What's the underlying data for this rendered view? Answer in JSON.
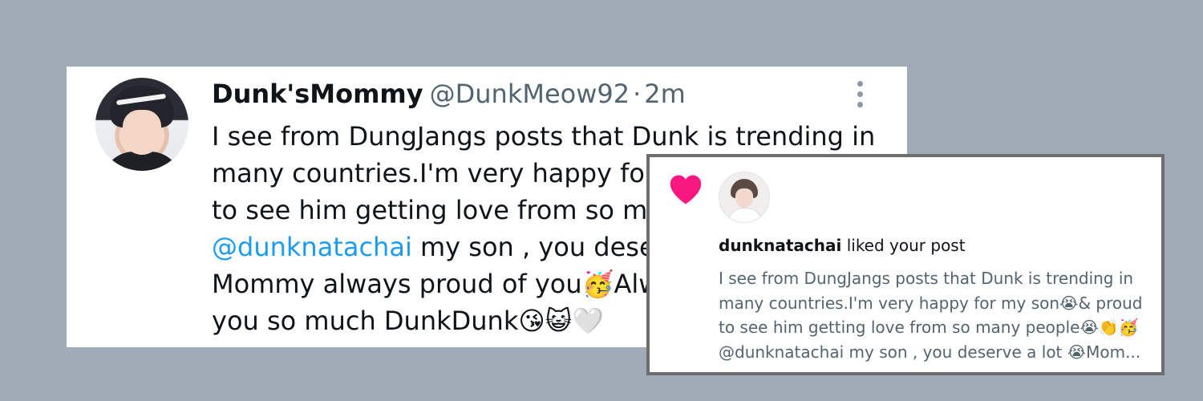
{
  "tweet": {
    "display_name": "Dunk'sMommy",
    "handle": "@DunkMeow92",
    "separator": "·",
    "time": "2m",
    "lines": [
      "I see from DungJangs posts that Dunk is trending in",
      "many countries.I'm very happy for my son😭& proud",
      "to see him getting love from so many people😭👏🥳",
      "my son , you deserve a lot 😭",
      "Mommy always proud of you🥳Always love",
      "you so much DunkDunk😘😺🤍"
    ],
    "mention": "@dunknatachai"
  },
  "notification": {
    "username": "dunknatachai",
    "action": "liked your post",
    "lines": [
      "I see from DungJangs posts that Dunk is trending in",
      "many countries.I'm very happy for my son😭& proud",
      "to see him getting love from so many people😭👏🥳",
      "my son , you deserve a lot 😭Mom..."
    ],
    "mention": "@dunknatachai"
  },
  "icons": {
    "heart": "heart-icon",
    "more": "more-options-icon"
  },
  "colors": {
    "background": "#a1abb7",
    "mention": "#1d9bf0",
    "heart": "#f91880",
    "secondary_text": "#536471"
  }
}
